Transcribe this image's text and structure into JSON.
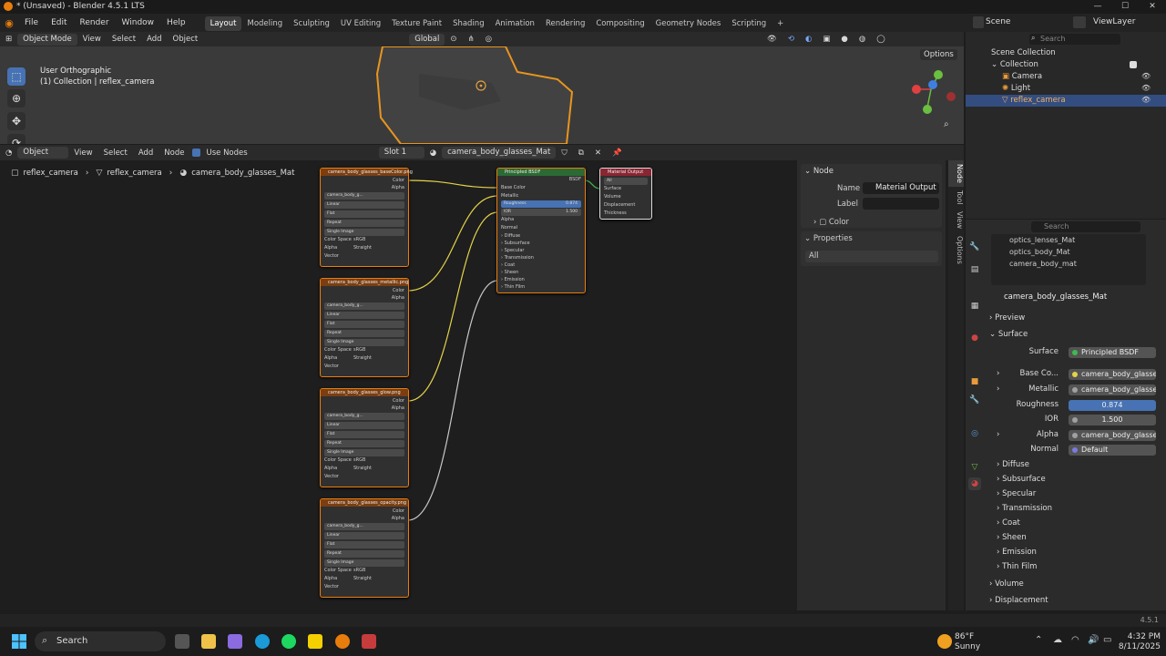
{
  "title": "* (Unsaved) - Blender 4.5.1 LTS",
  "menu": [
    "File",
    "Edit",
    "Render",
    "Window",
    "Help"
  ],
  "workspaces": [
    "Layout",
    "Modeling",
    "Sculpting",
    "UV Editing",
    "Texture Paint",
    "Shading",
    "Animation",
    "Rendering",
    "Compositing",
    "Geometry Nodes",
    "Scripting"
  ],
  "active_workspace": "Layout",
  "scene": "Scene",
  "view_layer": "ViewLayer",
  "viewport": {
    "mode": "Object Mode",
    "menus": [
      "View",
      "Select",
      "Add",
      "Object"
    ],
    "transform": "Global",
    "options": "Options",
    "view_name": "User Orthographic",
    "view_context": "(1) Collection | reflex_camera"
  },
  "node_editor": {
    "type": "Object",
    "menus": [
      "View",
      "Select",
      "Add",
      "Node"
    ],
    "use_nodes": "Use Nodes",
    "slot": "Slot 1",
    "material": "camera_body_glasses_Mat",
    "breadcrumb": [
      "reflex_camera",
      "reflex_camera",
      "camera_body_glasses_Mat"
    ]
  },
  "tex_nodes": [
    {
      "title": "camera_body_glasses_baseColor.png",
      "image": "camera_body_g..."
    },
    {
      "title": "camera_body_glasses_metallic.png",
      "image": "camera_body_g..."
    },
    {
      "title": "camera_body_glasses_glow.png",
      "image": "camera_body_g..."
    },
    {
      "title": "camera_body_glasses_opacity.png",
      "image": "camera_body_g..."
    }
  ],
  "tex_fields": {
    "outputs": [
      "Color",
      "Alpha"
    ],
    "interp": "Linear",
    "proj": "Flat",
    "ext": "Repeat",
    "source": "Single Image",
    "cs_label": "Color Space",
    "cs": "sRGB",
    "alpha_label": "Alpha",
    "alpha": "Straight",
    "vector": "Vector"
  },
  "bsdf": {
    "title": "Principled BSDF",
    "output": "BSDF",
    "base_color": "Base Color",
    "metallic": "Metallic",
    "roughness_label": "Roughness",
    "roughness": "0.874",
    "ior_label": "IOR",
    "ior": "1.500",
    "alpha": "Alpha",
    "normal": "Normal",
    "panels": [
      "Diffuse",
      "Subsurface",
      "Specular",
      "Transmission",
      "Coat",
      "Sheen",
      "Emission",
      "Thin Film"
    ]
  },
  "output_node": {
    "title": "Material Output",
    "target": "All",
    "inputs": [
      "Surface",
      "Volume",
      "Displacement",
      "Thickness"
    ]
  },
  "sidebar": {
    "node_header": "Node",
    "name_label": "Name",
    "name": "Material Output",
    "label_label": "Label",
    "color": "Color",
    "properties": "Properties",
    "target": "All",
    "tabs": [
      "Node",
      "Tool",
      "View",
      "Options"
    ]
  },
  "outliner": {
    "search_placeholder": "Search",
    "scene_collection": "Scene Collection",
    "collection": "Collection",
    "items": [
      "Camera",
      "Light",
      "reflex_camera"
    ]
  },
  "properties": {
    "search_placeholder": "Search",
    "materials": [
      "optics_lenses_Mat",
      "optics_body_Mat",
      "camera_body_mat"
    ],
    "material": "camera_body_glasses_Mat",
    "preview": "Preview",
    "surface": "Surface",
    "rows": [
      {
        "label": "Surface",
        "value": "Principled BSDF",
        "dot": "#3fb950"
      },
      {
        "label": "Base Co...",
        "value": "camera_body_glasse...",
        "dot": "#e4d34a"
      },
      {
        "label": "Metallic",
        "value": "camera_body_glasse...",
        "dot": "#a0a0a0"
      },
      {
        "label": "Roughness",
        "value": "0.874",
        "dot": ""
      },
      {
        "label": "IOR",
        "value": "1.500",
        "dot": "#a0a0a0"
      },
      {
        "label": "Alpha",
        "value": "camera_body_glasse...",
        "dot": "#a0a0a0"
      },
      {
        "label": "Normal",
        "value": "Default",
        "dot": "#7a7ae0"
      }
    ],
    "subpanels": [
      "Diffuse",
      "Subsurface",
      "Specular",
      "Transmission",
      "Coat",
      "Sheen",
      "Emission",
      "Thin Film"
    ],
    "volume": "Volume",
    "displacement": "Displacement"
  },
  "version": "4.5.1",
  "taskbar": {
    "search": "Search",
    "temp": "86°F",
    "weather": "Sunny",
    "time": "4:32 PM",
    "date": "8/11/2025"
  }
}
